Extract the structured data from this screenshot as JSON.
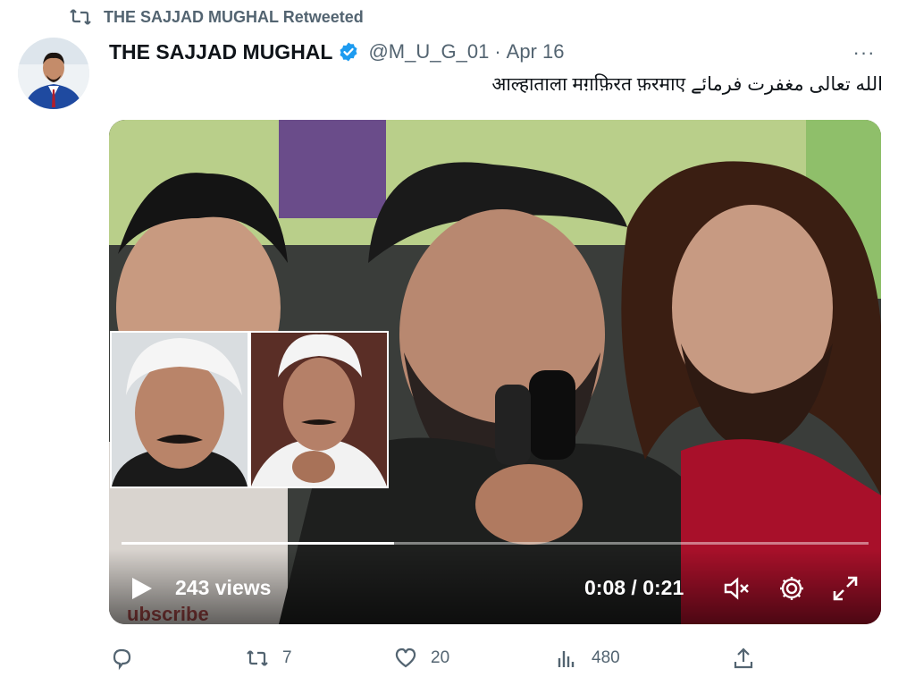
{
  "retweet_banner": {
    "text": "THE SAJJAD MUGHAL Retweeted",
    "icon": "retweet-icon"
  },
  "tweet": {
    "author_name": "THE SAJJAD MUGHAL",
    "verified": true,
    "handle": "@M_U_G_01",
    "separator": "·",
    "date": "Apr 16",
    "more_label": "···",
    "text": "الله تعالی مغفرت فرمائے  आल्हाताला मग़फ़िरत फ़रमाए"
  },
  "video": {
    "views": "243 views",
    "time": "0:08 / 0:21",
    "progress": 0.365,
    "icons": [
      "play-icon",
      "volume-muted-icon",
      "settings-gear-icon",
      "fullscreen-icon"
    ]
  },
  "actions": {
    "reply_count": "",
    "retweet_count": "7",
    "like_count": "20",
    "view_count": "480"
  },
  "colors": {
    "text_primary": "#0f1419",
    "text_secondary": "#536471",
    "verified_blue": "#1d9bf0"
  }
}
